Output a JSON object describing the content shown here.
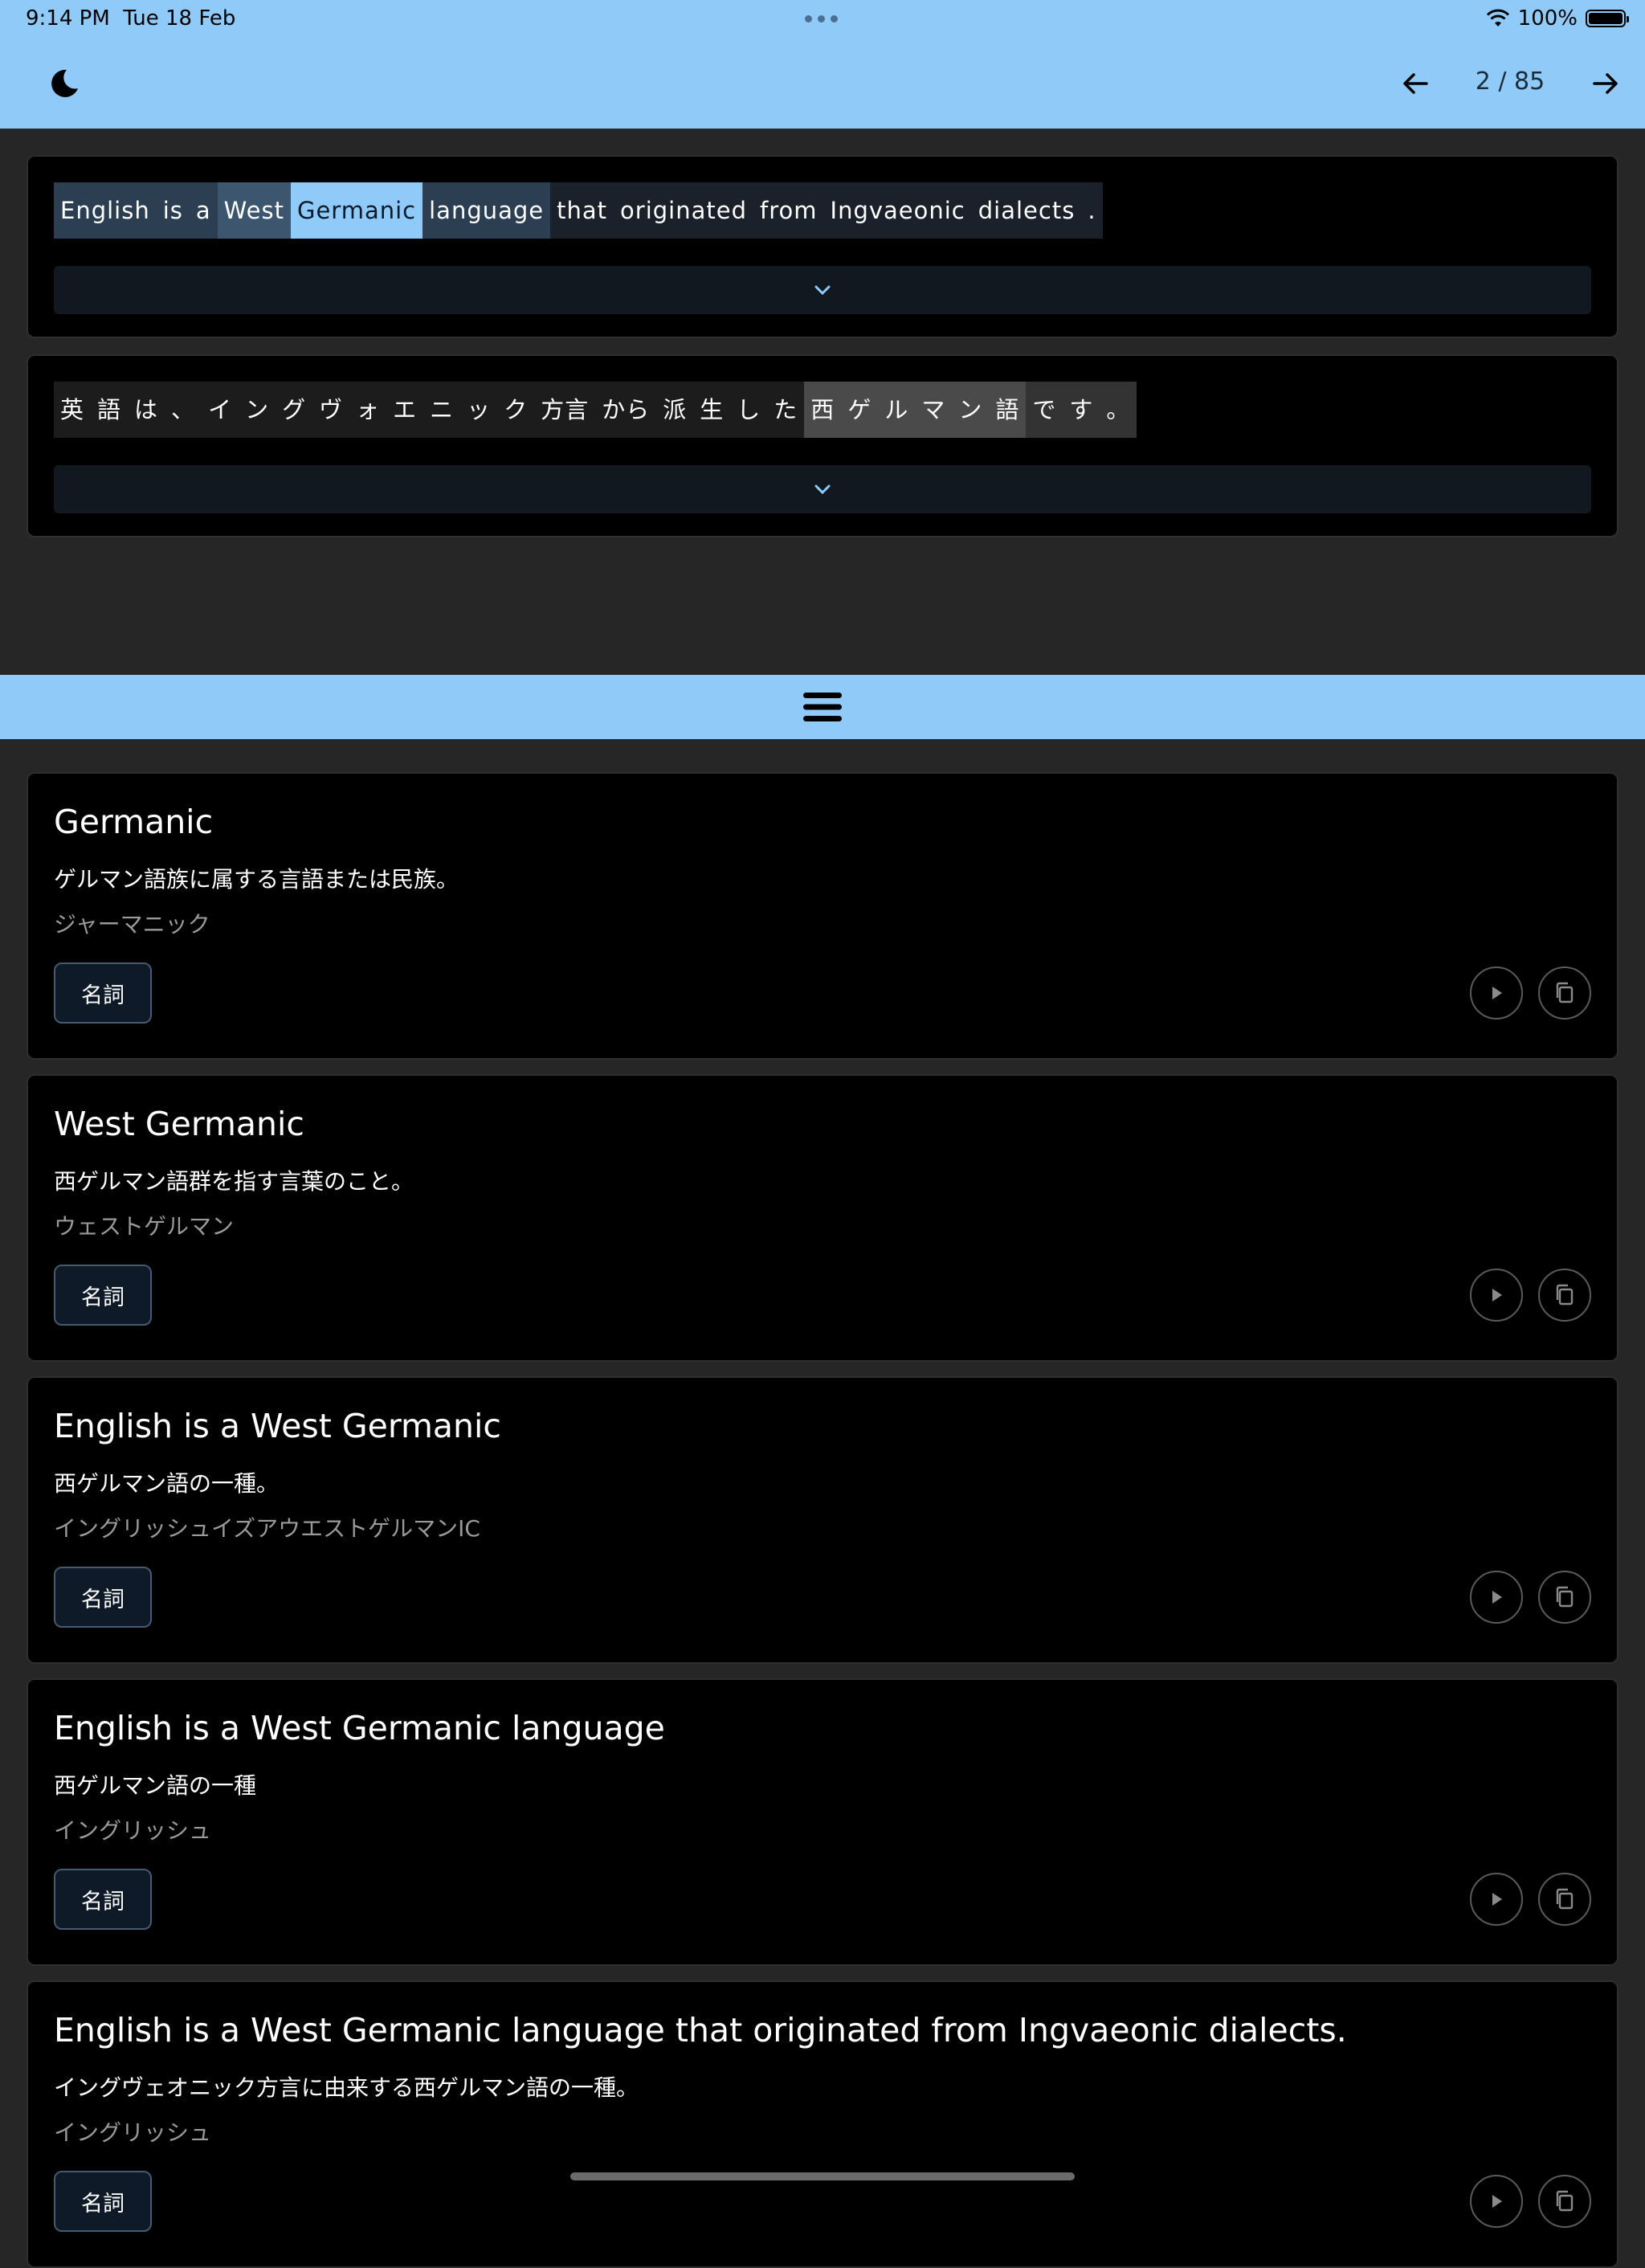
{
  "status_bar": {
    "time": "9:14 PM",
    "date": "Tue 18 Feb",
    "battery": "100%"
  },
  "app_bar": {
    "page_counter": "2 / 85",
    "icons": [
      "moon-icon",
      "arrow-left-icon",
      "arrow-right-icon"
    ]
  },
  "source_sentence": {
    "tokens": [
      {
        "text": "English",
        "bg": "#2c3f52"
      },
      {
        "text": "is",
        "bg": "#2c3f52"
      },
      {
        "text": "a",
        "bg": "#2c3f52"
      },
      {
        "text": "West",
        "bg": "#3c566f"
      },
      {
        "text": "Germanic",
        "bg": "#90caf9"
      },
      {
        "text": "language",
        "bg": "#2c3f52"
      },
      {
        "text": "that",
        "bg": "#1a212a"
      },
      {
        "text": "originated",
        "bg": "#1a212a"
      },
      {
        "text": "from",
        "bg": "#1a212a"
      },
      {
        "text": "Ingvaeonic",
        "bg": "#1a212a"
      },
      {
        "text": "dialects",
        "bg": "#1a212a"
      },
      {
        "text": ".",
        "bg": "#1a212a"
      }
    ]
  },
  "target_sentence": {
    "tokens": [
      {
        "text": "英",
        "bg": "#1c1c1c"
      },
      {
        "text": "語",
        "bg": "#1c1c1c"
      },
      {
        "text": "は",
        "bg": "#1c1c1c"
      },
      {
        "text": "、",
        "bg": "#1c1c1c"
      },
      {
        "text": "イ",
        "bg": "#1c1c1c"
      },
      {
        "text": "ン",
        "bg": "#1c1c1c"
      },
      {
        "text": "グ",
        "bg": "#1c1c1c"
      },
      {
        "text": "ヴ",
        "bg": "#1c1c1c"
      },
      {
        "text": "ォ",
        "bg": "#1c1c1c"
      },
      {
        "text": "エ",
        "bg": "#1c1c1c"
      },
      {
        "text": "ニ",
        "bg": "#1c1c1c"
      },
      {
        "text": "ッ",
        "bg": "#1c1c1c"
      },
      {
        "text": "ク",
        "bg": "#1c1c1c"
      },
      {
        "text": "方言",
        "bg": "#1c1c1c"
      },
      {
        "text": "から",
        "bg": "#1c1c1c"
      },
      {
        "text": "派",
        "bg": "#1c1c1c"
      },
      {
        "text": "生",
        "bg": "#1c1c1c"
      },
      {
        "text": "し",
        "bg": "#1c1c1c"
      },
      {
        "text": "た",
        "bg": "#1c1c1c"
      },
      {
        "text": "西",
        "bg": "#4a4a4a"
      },
      {
        "text": "ゲ",
        "bg": "#4a4a4a"
      },
      {
        "text": "ル",
        "bg": "#4a4a4a"
      },
      {
        "text": "マ",
        "bg": "#4a4a4a"
      },
      {
        "text": "ン",
        "bg": "#4a4a4a"
      },
      {
        "text": "語",
        "bg": "#4a4a4a"
      },
      {
        "text": "で",
        "bg": "#333333"
      },
      {
        "text": "す",
        "bg": "#333333"
      },
      {
        "text": "。",
        "bg": "#333333"
      }
    ]
  },
  "entries": [
    {
      "title": "Germanic",
      "meaning": "ゲルマン語族に属する言語または民族。",
      "reading": "ジャーマニック",
      "pos": "名詞"
    },
    {
      "title": "West Germanic",
      "meaning": "西ゲルマン語群を指す言葉のこと。",
      "reading": "ウェストゲルマン",
      "pos": "名詞"
    },
    {
      "title": "English is a West Germanic",
      "meaning": "西ゲルマン語の一種。",
      "reading": "イングリッシュイズアウエストゲルマンIC",
      "pos": "名詞"
    },
    {
      "title": "English is a West Germanic language",
      "meaning": "西ゲルマン語の一種",
      "reading": "イングリッシュ",
      "pos": "名詞"
    },
    {
      "title": "English is a West Germanic language that originated from Ingvaeonic dialects.",
      "meaning": "イングヴェオニック方言に由来する西ゲルマン語の一種。",
      "reading": "イングリッシュ",
      "pos": "名詞"
    }
  ],
  "colors": {
    "accent": "#90caf9",
    "background": "#262626",
    "card": "#000000"
  }
}
